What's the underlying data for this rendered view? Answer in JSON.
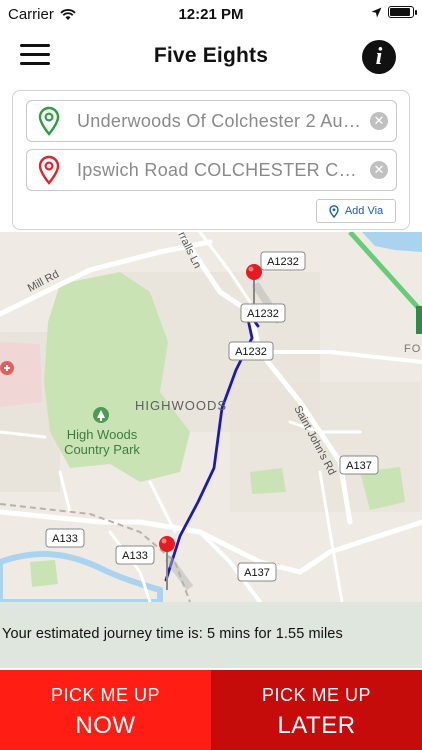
{
  "status_bar": {
    "carrier": "Carrier",
    "time": "12:21 PM",
    "battery_level": 0.9
  },
  "header": {
    "title": "Five Eights",
    "info_label": "i"
  },
  "journey_form": {
    "pickup_value": "Underwoods Of Colchester 2 Au…",
    "dropoff_value": "Ipswich Road COLCHESTER CO…",
    "add_via_label": "Add Via",
    "pickup_pin_color": "#2e9e3e",
    "dropoff_pin_color": "#e0262d"
  },
  "map": {
    "road_labels": [
      "A1232",
      "A1232",
      "A1232",
      "A137",
      "A133",
      "A133",
      "A137"
    ],
    "street_labels": [
      "Mill Rd",
      "Saint John's Rd",
      "rralls Ln"
    ],
    "area_label": "HIGHWOODS",
    "park_label_line1": "High Woods",
    "park_label_line2": "Country Park",
    "edge_label": "FO",
    "route_color": "#1c1ab0"
  },
  "journey_info": {
    "text": "Your estimated journey time is: 5 mins for 1.55 miles"
  },
  "actions": {
    "now_line1": "PICK ME UP",
    "now_line2": "NOW",
    "later_line1": "PICK ME UP",
    "later_line2": "LATER",
    "now_color": "#ff1d14",
    "later_color": "#c60b0b"
  }
}
